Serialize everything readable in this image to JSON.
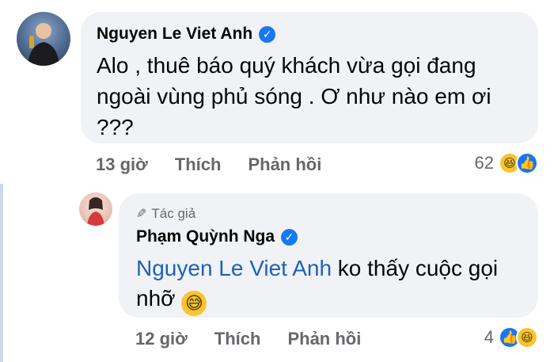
{
  "comment1": {
    "author": "Nguyen Le Viet Anh",
    "text": "Alo , thuê báo quý khách vừa gọi đang ngoài vùng phủ sóng . Ơ như nào em ơi ???",
    "time": "13 giờ",
    "like_label": "Thích",
    "reply_label": "Phản hồi",
    "reaction_count": "62",
    "reactions": [
      "haha-icon",
      "like-icon"
    ]
  },
  "comment2": {
    "badge": "Tác giả",
    "author": "Phạm Quỳnh Nga",
    "mention": "Nguyen Le Viet Anh",
    "text": " ko thấy cuộc gọi nhỡ ",
    "time": "12 giờ",
    "like_label": "Thích",
    "reply_label": "Phản hồi",
    "reaction_count": "4",
    "reactions": [
      "like-icon",
      "haha-icon"
    ]
  },
  "colors": {
    "bubble": "#f0f2f5",
    "mention": "#1d62b7",
    "meta": "#65676b",
    "verified": "#1877f2"
  }
}
